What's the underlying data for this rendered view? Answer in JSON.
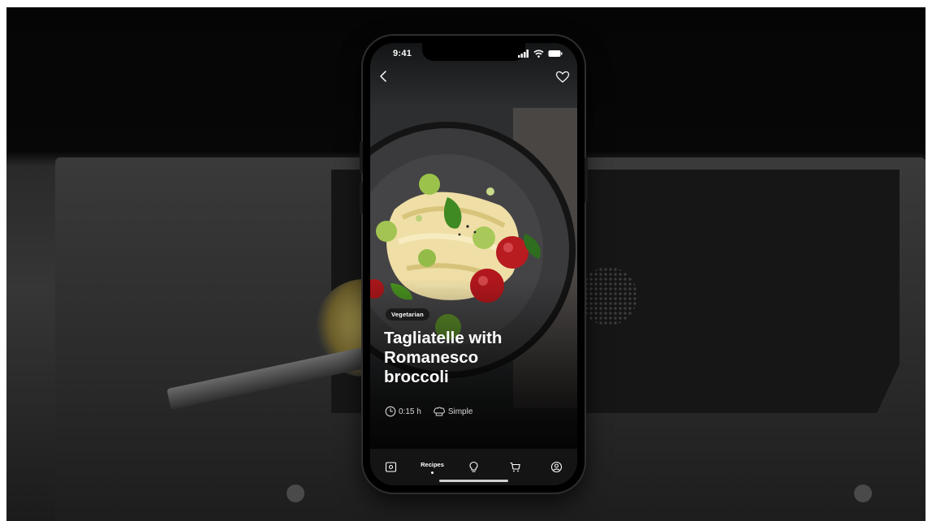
{
  "status_bar": {
    "time": "9:41"
  },
  "recipe": {
    "tag": "Vegetarian",
    "title_lines": [
      "Tagliatelle with",
      "Romanesco",
      "broccoli"
    ],
    "duration": "0:15 h",
    "difficulty": "Simple"
  },
  "tab_bar": {
    "active_label": "Recipes",
    "tabs": [
      "camera-icon",
      "recipes",
      "lightbulb-icon",
      "cart-icon",
      "profile-icon"
    ]
  }
}
